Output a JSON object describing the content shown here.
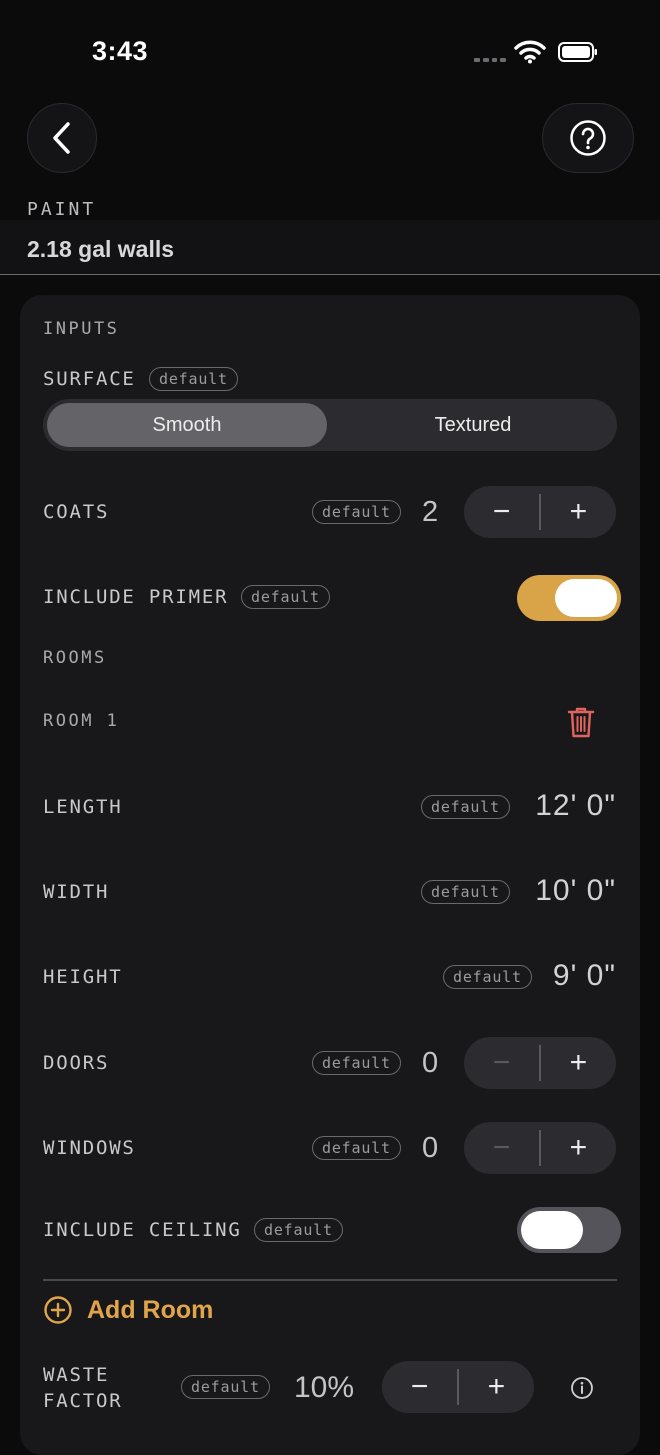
{
  "status_bar": {
    "time": "3:43"
  },
  "header": {
    "section_label": "PAINT",
    "result": "2.18 gal walls"
  },
  "inputs": {
    "title": "INPUTS",
    "default_badge": "default",
    "surface": {
      "label": "SURFACE",
      "options": [
        "Smooth",
        "Textured"
      ],
      "selected": "Smooth"
    },
    "coats": {
      "label": "COATS",
      "value": "2"
    },
    "include_primer": {
      "label": "INCLUDE PRIMER",
      "on": true
    },
    "rooms": {
      "title": "ROOMS",
      "room": {
        "name": "ROOM 1",
        "length": {
          "label": "LENGTH",
          "value": "12' 0\""
        },
        "width": {
          "label": "WIDTH",
          "value": "10' 0\""
        },
        "height": {
          "label": "HEIGHT",
          "value": "9' 0\""
        },
        "doors": {
          "label": "DOORS",
          "value": "0"
        },
        "windows": {
          "label": "WINDOWS",
          "value": "0"
        },
        "include_ceiling": {
          "label": "INCLUDE CEILING",
          "on": false
        }
      },
      "add_room": "Add Room"
    },
    "waste_factor": {
      "label_line1": "WASTE",
      "label_line2": "FACTOR",
      "value": "10%"
    }
  },
  "colors": {
    "accent": "#d9a347",
    "delete": "#e0645c",
    "background": "#0b0b0c",
    "card": "#18181b"
  },
  "icons": [
    "back-chevron-icon",
    "help-icon",
    "wifi-icon",
    "battery-icon",
    "trash-icon",
    "add-circle-icon",
    "info-icon"
  ]
}
